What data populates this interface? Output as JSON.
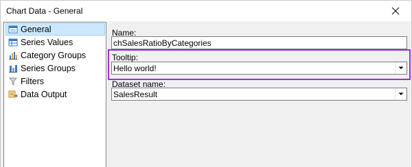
{
  "window": {
    "title": "Chart Data - General"
  },
  "sidebar": {
    "items": [
      {
        "label": "General",
        "icon": "general-icon",
        "selected": true
      },
      {
        "label": "Series Values",
        "icon": "series-values-icon",
        "selected": false
      },
      {
        "label": "Category Groups",
        "icon": "category-groups-icon",
        "selected": false
      },
      {
        "label": "Series Groups",
        "icon": "series-groups-icon",
        "selected": false
      },
      {
        "label": "Filters",
        "icon": "filter-icon",
        "selected": false
      },
      {
        "label": "Data Output",
        "icon": "data-output-icon",
        "selected": false
      }
    ]
  },
  "form": {
    "name_label": "Name:",
    "name_value": "chSalesRatioByCategories",
    "tooltip_label": "Tooltip:",
    "tooltip_value": "Hello world!",
    "dataset_label": "Dataset name:",
    "dataset_value": "SalesResult"
  },
  "colors": {
    "highlight": "#9b30d9",
    "selection": "#cce8ff"
  }
}
